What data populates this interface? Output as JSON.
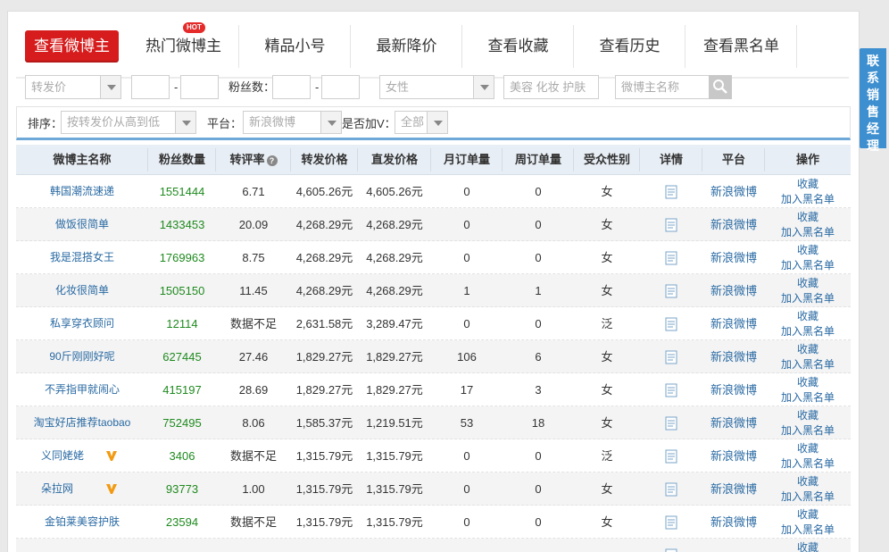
{
  "tabs": [
    {
      "label": "查看微博主",
      "active": true
    },
    {
      "label": "热门微博主",
      "badge": "HOT"
    },
    {
      "label": "精品小号"
    },
    {
      "label": "最新降价"
    },
    {
      "label": "查看收藏"
    },
    {
      "label": "查看历史"
    },
    {
      "label": "查看黑名单"
    }
  ],
  "filters": {
    "price_type": "转发价",
    "range_dash": "-",
    "fans_label": "粉丝数：",
    "gender": "女性",
    "tags_placeholder": "美容 化妆 护肤",
    "name_placeholder": "微博主名称"
  },
  "sort": {
    "label": "排序：",
    "value": "按转发价从高到低",
    "platform_label": "平台：",
    "platform_value": "新浪微博",
    "verified_label": "是否加V：",
    "verified_value": "全部"
  },
  "table": {
    "headers": [
      "微博主名称",
      "粉丝数量",
      "转评率",
      "转发价格",
      "直发价格",
      "月订单量",
      "周订单量",
      "受众性别",
      "详情",
      "平台",
      "操作"
    ],
    "op_favorite": "收藏",
    "op_blacklist": "加入黑名单",
    "rows": [
      {
        "name": "韩国潮流速递",
        "fans": "1551444",
        "rate": "6.71",
        "repost": "4,605.26元",
        "direct": "4,605.26元",
        "monthly": "0",
        "weekly": "0",
        "gender": "女",
        "platform": "新浪微博",
        "verified": false
      },
      {
        "name": "做饭很简单",
        "fans": "1433453",
        "rate": "20.09",
        "repost": "4,268.29元",
        "direct": "4,268.29元",
        "monthly": "0",
        "weekly": "0",
        "gender": "女",
        "platform": "新浪微博",
        "verified": false
      },
      {
        "name": "我是混搭女王",
        "fans": "1769963",
        "rate": "8.75",
        "repost": "4,268.29元",
        "direct": "4,268.29元",
        "monthly": "0",
        "weekly": "0",
        "gender": "女",
        "platform": "新浪微博",
        "verified": false
      },
      {
        "name": "化妆很简单",
        "fans": "1505150",
        "rate": "11.45",
        "repost": "4,268.29元",
        "direct": "4,268.29元",
        "monthly": "1",
        "weekly": "1",
        "gender": "女",
        "platform": "新浪微博",
        "verified": false
      },
      {
        "name": "私享穿衣顾问",
        "fans": "12114",
        "rate": "数据不足",
        "repost": "2,631.58元",
        "direct": "3,289.47元",
        "monthly": "0",
        "weekly": "0",
        "gender": "泛",
        "platform": "新浪微博",
        "verified": false
      },
      {
        "name": "90斤刚刚好呢",
        "fans": "627445",
        "rate": "27.46",
        "repost": "1,829.27元",
        "direct": "1,829.27元",
        "monthly": "106",
        "weekly": "6",
        "gender": "女",
        "platform": "新浪微博",
        "verified": false
      },
      {
        "name": "不弄指甲就闹心",
        "fans": "415197",
        "rate": "28.69",
        "repost": "1,829.27元",
        "direct": "1,829.27元",
        "monthly": "17",
        "weekly": "3",
        "gender": "女",
        "platform": "新浪微博",
        "verified": false
      },
      {
        "name": "淘宝好店推荐taobao",
        "fans": "752495",
        "rate": "8.06",
        "repost": "1,585.37元",
        "direct": "1,219.51元",
        "monthly": "53",
        "weekly": "18",
        "gender": "女",
        "platform": "新浪微博",
        "verified": false
      },
      {
        "name": "义同姥姥",
        "fans": "3406",
        "rate": "数据不足",
        "repost": "1,315.79元",
        "direct": "1,315.79元",
        "monthly": "0",
        "weekly": "0",
        "gender": "泛",
        "platform": "新浪微博",
        "verified": true
      },
      {
        "name": "朵拉网",
        "fans": "93773",
        "rate": "1.00",
        "repost": "1,315.79元",
        "direct": "1,315.79元",
        "monthly": "0",
        "weekly": "0",
        "gender": "女",
        "platform": "新浪微博",
        "verified": true
      },
      {
        "name": "金铂莱美容护肤",
        "fans": "23594",
        "rate": "数据不足",
        "repost": "1,315.79元",
        "direct": "1,315.79元",
        "monthly": "0",
        "weekly": "0",
        "gender": "女",
        "platform": "新浪微博",
        "verified": false
      },
      {
        "name": "",
        "fans": "",
        "rate": "",
        "repost": "",
        "direct": "",
        "monthly": "",
        "weekly": "",
        "gender": "",
        "platform": "",
        "verified": false
      }
    ]
  },
  "side_tab": [
    "联",
    "系",
    "销",
    "售",
    "经",
    "理"
  ],
  "colors": {
    "accent": "#d61c1c",
    "link": "#2a6aa3",
    "fans": "#1f8a1f",
    "side": "#3d8fcf"
  }
}
